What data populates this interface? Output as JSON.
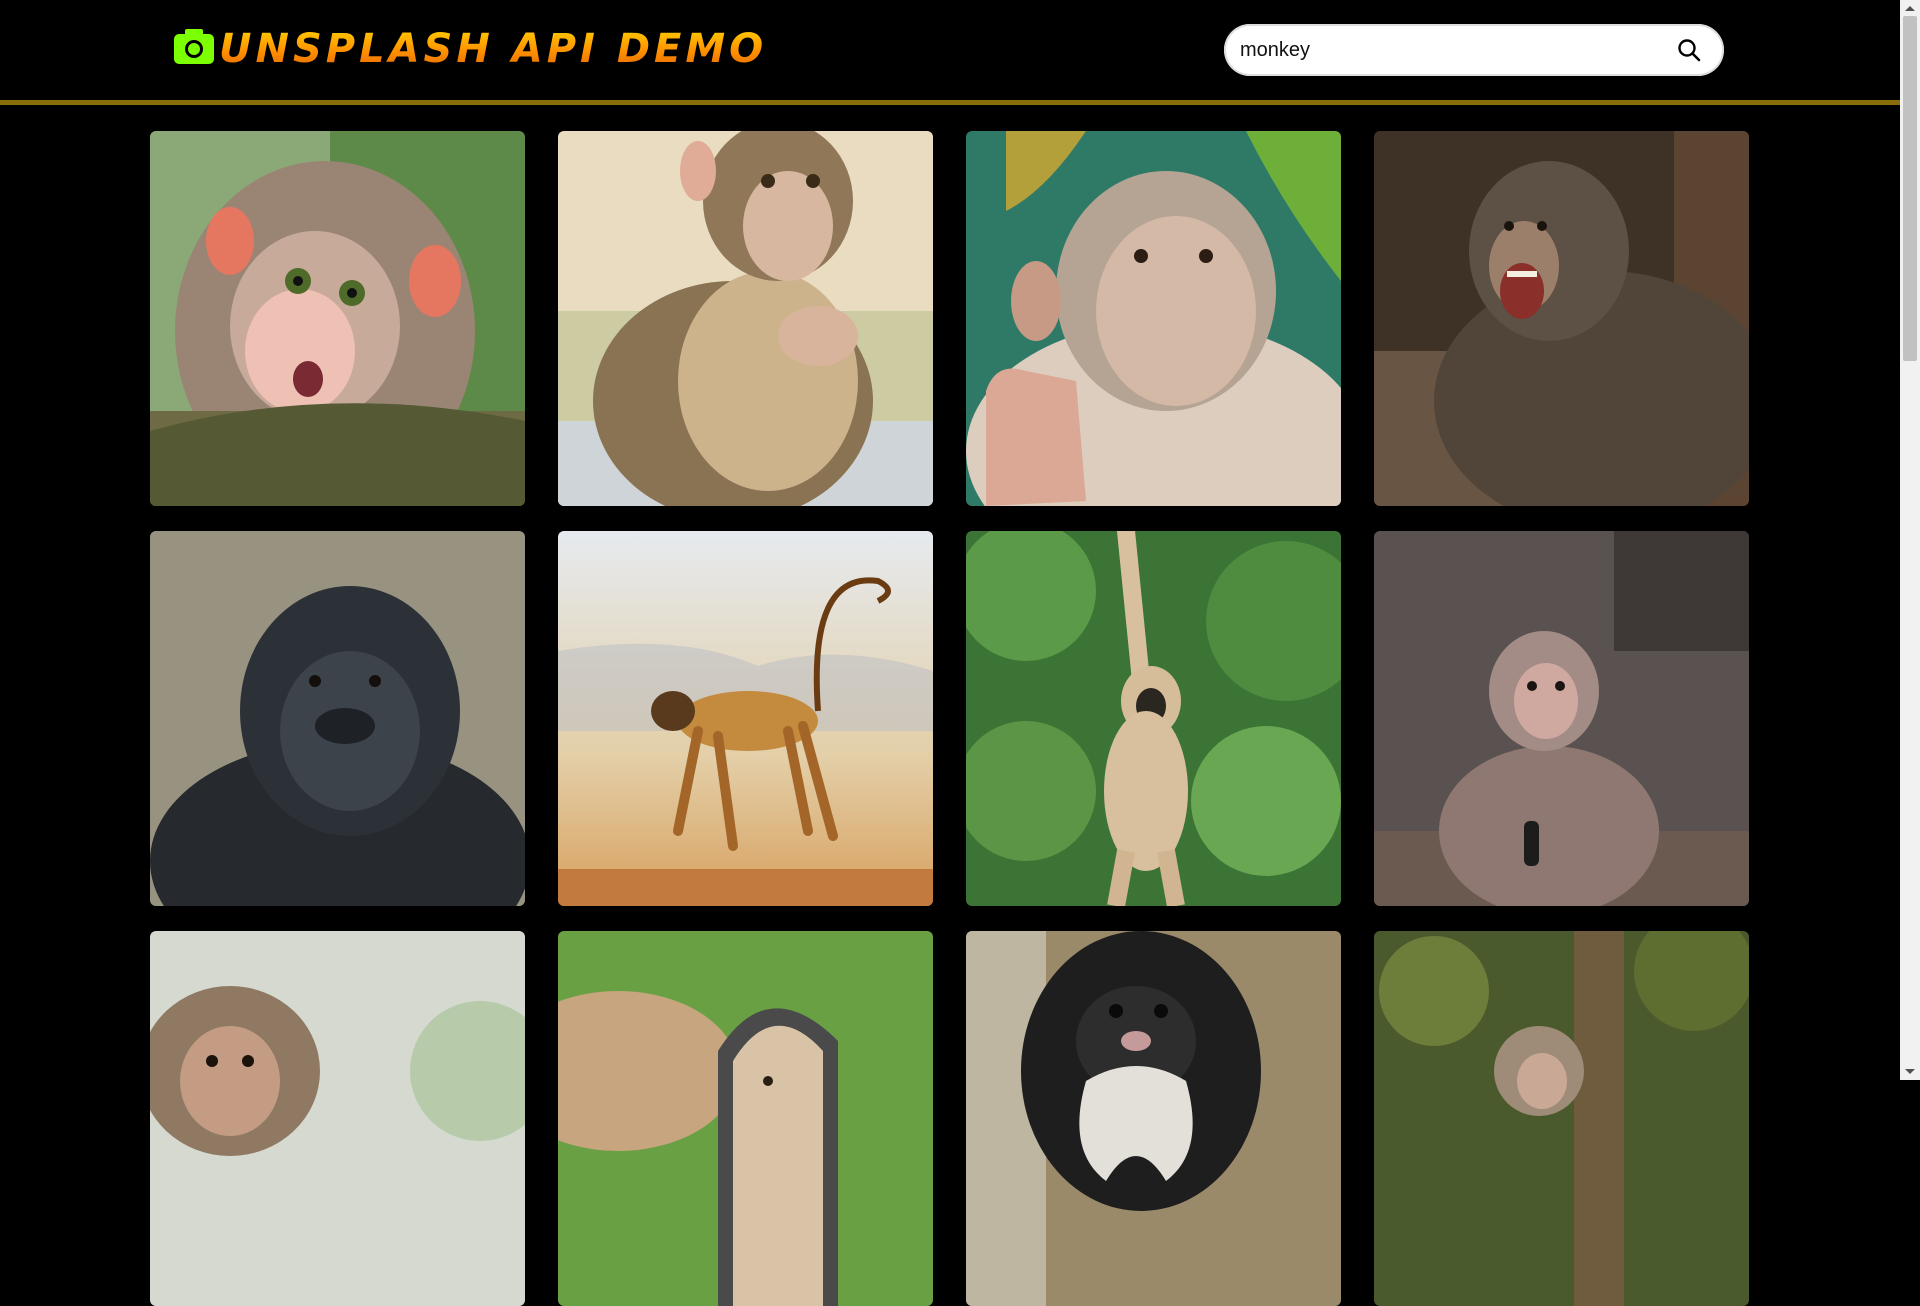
{
  "header": {
    "logo_text": "UNSPLASH API DEMO",
    "logo_icon": "camera-icon",
    "logo_color": "#7cff00"
  },
  "search": {
    "value": "monkey",
    "icon": "search-icon"
  },
  "gallery": {
    "photos": [
      {
        "subject": "baby-macaque-on-branch",
        "colors": [
          "#6f9a54",
          "#a58b77",
          "#e9b8a8"
        ]
      },
      {
        "subject": "macaque-sitting",
        "colors": [
          "#d9c7a5",
          "#8e7656",
          "#efe2c8"
        ]
      },
      {
        "subject": "bonnet-macaque-waving",
        "colors": [
          "#3d8b6f",
          "#c9b8a4",
          "#e7d9cc"
        ]
      },
      {
        "subject": "macaque-yelling",
        "colors": [
          "#4a3a2c",
          "#6e5f4d",
          "#9a826a"
        ]
      },
      {
        "subject": "gorilla-portrait",
        "colors": [
          "#8a8676",
          "#2b3138",
          "#55575a"
        ]
      },
      {
        "subject": "langur-walking",
        "colors": [
          "#dfe4ea",
          "#c8a16a",
          "#b56e2d"
        ]
      },
      {
        "subject": "gibbon-hanging",
        "colors": [
          "#3f7d3a",
          "#d8bf9e",
          "#6eaa4e"
        ]
      },
      {
        "subject": "young-macaque-sitting",
        "colors": [
          "#5f5552",
          "#a08a84",
          "#7d6c66"
        ]
      },
      {
        "subject": "baby-macaque-closeup",
        "colors": [
          "#d9ddd3",
          "#8a7560",
          "#a9c59a"
        ]
      },
      {
        "subject": "monkey-with-mirror",
        "colors": [
          "#6aa044",
          "#c7a57e",
          "#e8d6bd"
        ]
      },
      {
        "subject": "emperor-tamarin",
        "colors": [
          "#9a8a6a",
          "#1e1e1e",
          "#d8d4cc"
        ]
      },
      {
        "subject": "macaque-in-forest",
        "colors": [
          "#4a5a2a",
          "#6f5b3d",
          "#9e8b78"
        ]
      }
    ]
  }
}
